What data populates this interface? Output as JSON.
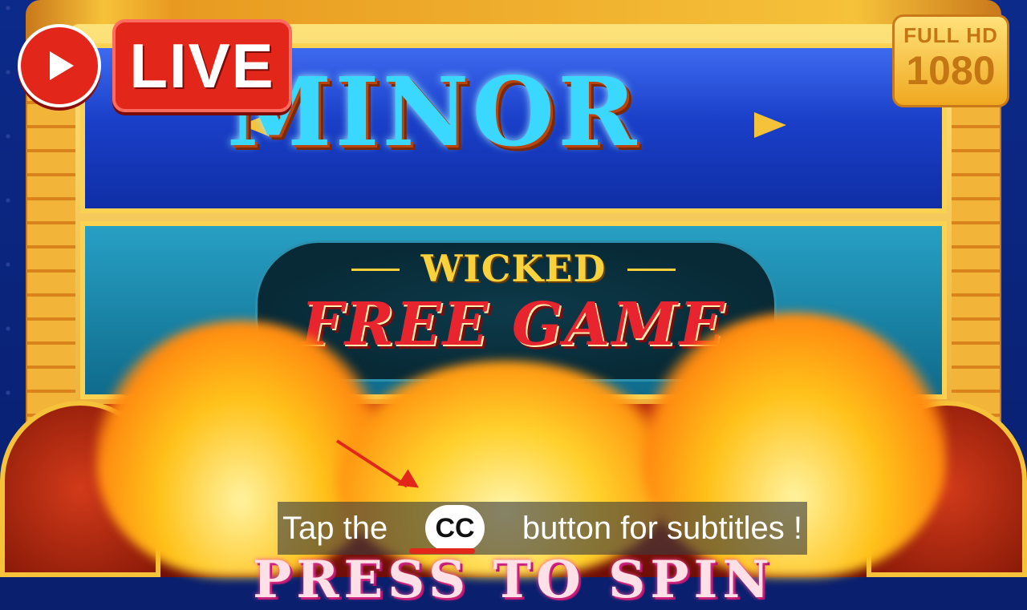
{
  "game": {
    "jackpot_label": "MINOR",
    "feature_top": "WICKED",
    "feature_main": "FREE GAME",
    "bottom_prompt": "PRESS TO SPIN"
  },
  "overlay": {
    "live_label": "LIVE",
    "quality_top": "FULL HD",
    "quality_bottom": "1080",
    "play_icon": "play-icon"
  },
  "subtitle": {
    "prefix": "Tap the",
    "cc_label": "CC",
    "suffix": "button for subtitles !"
  },
  "colors": {
    "accent_red": "#e2261a",
    "gold": "#f6c23a",
    "jackpot_blue": "#3ad8ff"
  }
}
